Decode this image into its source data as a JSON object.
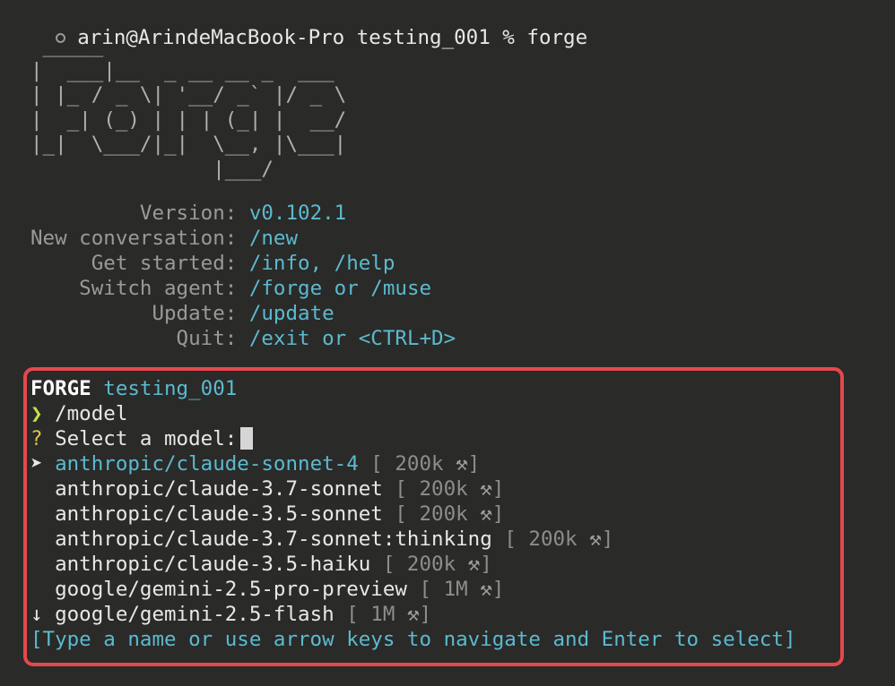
{
  "shell": {
    "prompt": "arin@ArindeMacBook-Pro testing_001 % forge"
  },
  "banner": {
    "ascii_art": " _____\n|  ___|__  _ __ __ _  ___\n| |_ / _ \\| '__/ _` |/ _ \\\n|  _| (_) | | | (_| |  __/\n|_|  \\___/|_|  \\__, |\\___|\n               |___/"
  },
  "info": [
    {
      "label": "         Version: ",
      "value": "v0.102.1"
    },
    {
      "label": "New conversation: ",
      "value": "/new"
    },
    {
      "label": "     Get started: ",
      "value": "/info, /help"
    },
    {
      "label": "    Switch agent: ",
      "value": "/forge or /muse"
    },
    {
      "label": "          Update: ",
      "value": "/update"
    },
    {
      "label": "            Quit: ",
      "value": "/exit or <CTRL+D>"
    }
  ],
  "session": {
    "app_name": "FORGE",
    "workspace": "testing_001",
    "prompt_symbol": "❯",
    "command": "/model",
    "question_symbol": "?",
    "question": "Select a model:",
    "selector_symbol": "➤",
    "scroll_symbol": "↓",
    "models": [
      {
        "name": "anthropic/claude-sonnet-4",
        "meta_open": "[ 200k",
        "meta_close": "]",
        "icon": "tool-icon",
        "selected": true
      },
      {
        "name": "anthropic/claude-3.7-sonnet",
        "meta_open": "[ 200k",
        "meta_close": "]",
        "icon": "tool-icon",
        "selected": false
      },
      {
        "name": "anthropic/claude-3.5-sonnet",
        "meta_open": "[ 200k",
        "meta_close": "]",
        "icon": "tool-icon",
        "selected": false
      },
      {
        "name": "anthropic/claude-3.7-sonnet:thinking",
        "meta_open": "[ 200k",
        "meta_close": "]",
        "icon": "tool-icon",
        "selected": false
      },
      {
        "name": "anthropic/claude-3.5-haiku",
        "meta_open": "[ 200k",
        "meta_close": "]",
        "icon": "tool-icon",
        "selected": false
      },
      {
        "name": "google/gemini-2.5-pro-preview",
        "meta_open": "[ 1M",
        "meta_close": "]",
        "icon": "tool-icon",
        "selected": false
      },
      {
        "name": "google/gemini-2.5-flash",
        "meta_open": "[ 1M",
        "meta_close": "]",
        "icon": "tool-icon",
        "selected": false
      }
    ],
    "hint": "[Type a name or use arrow keys to navigate and Enter to select]"
  },
  "colors": {
    "background": "#2a2a28",
    "accent_cyan": "#5bbad0",
    "prompt_green": "#c6e04a",
    "question_yellow": "#d7c74a",
    "highlight_red": "#e5484d"
  }
}
